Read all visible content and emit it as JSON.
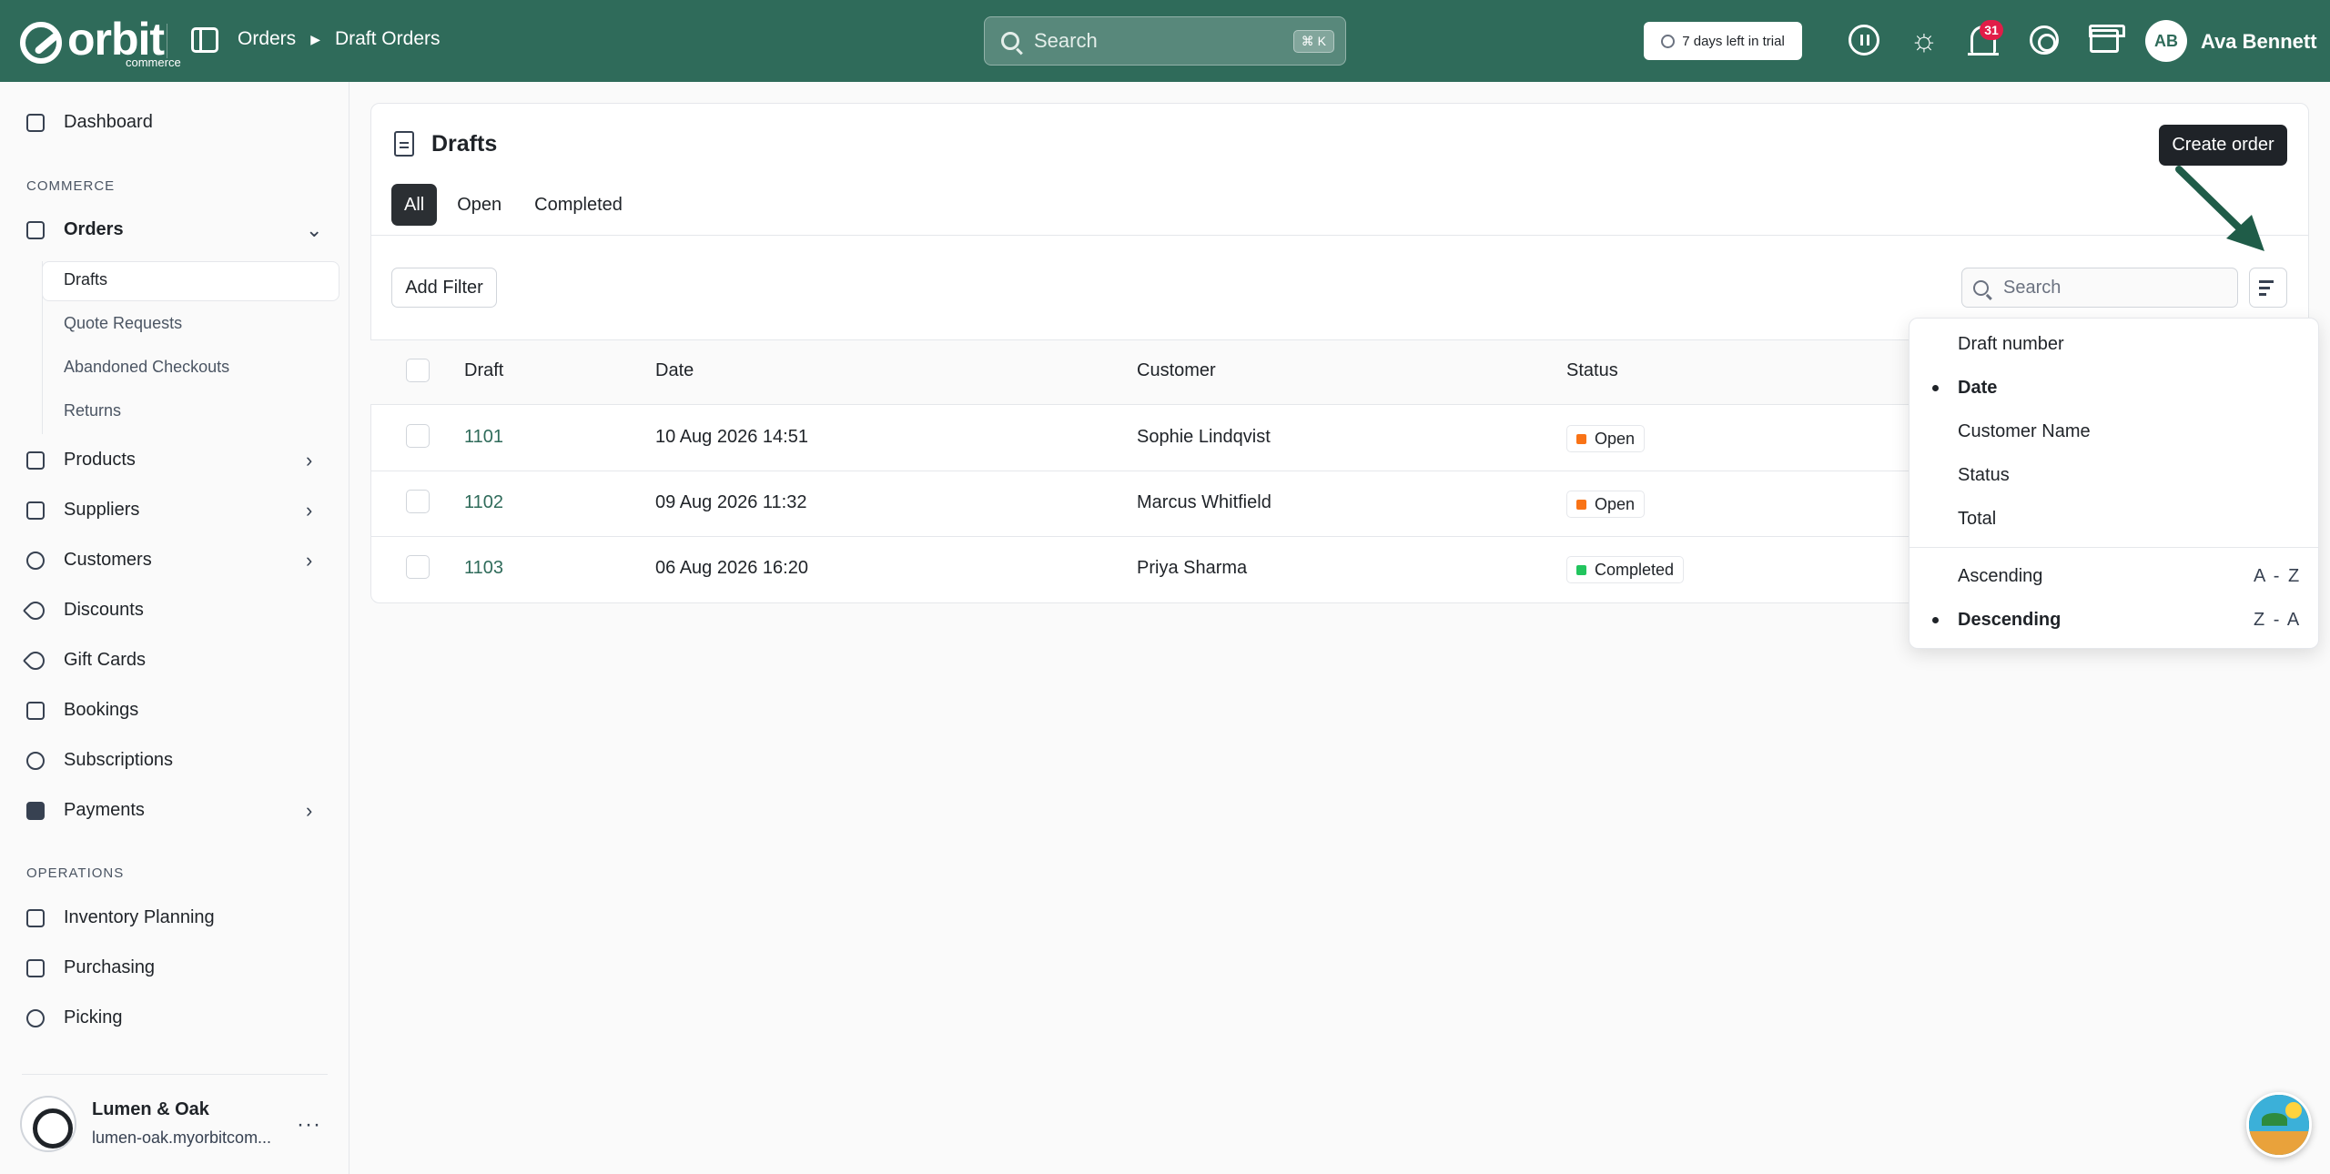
{
  "app": {
    "logo_text": "orbit",
    "logo_subtext": "commerce",
    "brand_color": "#2f6b5a"
  },
  "breadcrumb": {
    "items": [
      "Orders",
      "Draft Orders"
    ]
  },
  "topbar": {
    "search_placeholder": "Search",
    "search_shortcut": "⌘ K",
    "trial_text": "7 days left in trial",
    "notification_count": "31",
    "user_initials": "AB",
    "user_name": "Ava Bennett",
    "icons": [
      "panel-toggle-icon",
      "pause-icon",
      "sun-icon",
      "bell-icon",
      "lifebuoy-icon",
      "store-icon"
    ]
  },
  "sidebar": {
    "dashboard": "Dashboard",
    "section_commerce": "COMMERCE",
    "orders": "Orders",
    "orders_sub": [
      "Drafts",
      "Quote Requests",
      "Abandoned Checkouts",
      "Returns"
    ],
    "items": [
      "Products",
      "Suppliers",
      "Customers",
      "Discounts",
      "Gift Cards",
      "Bookings",
      "Subscriptions",
      "Payments"
    ],
    "section_operations": "OPERATIONS",
    "operations": [
      "Inventory Planning",
      "Purchasing",
      "Picking"
    ],
    "store_name": "Lumen & Oak",
    "store_url": "lumen-oak.myorbitcom..."
  },
  "page": {
    "title": "Drafts",
    "create_button": "Create order",
    "tabs": [
      "All",
      "Open",
      "Completed"
    ],
    "active_tab": "All",
    "add_filter": "Add Filter",
    "table_search_placeholder": "Search"
  },
  "table": {
    "columns": [
      "Draft",
      "Date",
      "Customer",
      "Status"
    ],
    "rows": [
      {
        "draft": "1101",
        "date": "10 Aug 2026 14:51",
        "customer": "Sophie Lindqvist",
        "status": "Open",
        "status_color": "#f97316"
      },
      {
        "draft": "1102",
        "date": "09 Aug 2026 11:32",
        "customer": "Marcus Whitfield",
        "status": "Open",
        "status_color": "#f97316"
      },
      {
        "draft": "1103",
        "date": "06 Aug 2026 16:20",
        "customer": "Priya Sharma",
        "status": "Completed",
        "status_color": "#22c55e"
      }
    ]
  },
  "sort_menu": {
    "fields": [
      "Draft number",
      "Date",
      "Customer Name",
      "Status",
      "Total"
    ],
    "selected_field": "Date",
    "orders": [
      {
        "label": "Ascending",
        "hint": "A - Z"
      },
      {
        "label": "Descending",
        "hint": "Z - A"
      }
    ],
    "selected_order": "Descending"
  }
}
